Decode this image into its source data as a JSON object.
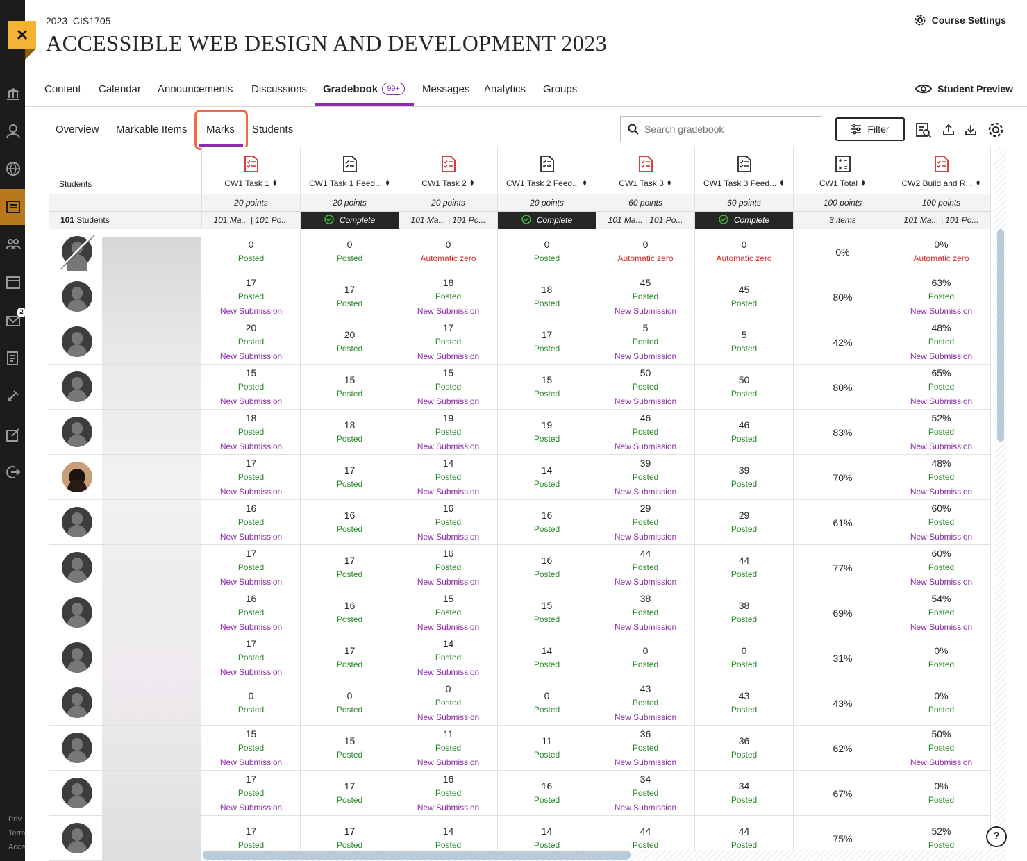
{
  "header": {
    "course_code": "2023_CIS1705",
    "course_title": "ACCESSIBLE WEB DESIGN AND DEVELOPMENT 2023",
    "settings_label": "Course Settings"
  },
  "course_nav": {
    "tabs": [
      "Content",
      "Calendar",
      "Announcements",
      "Discussions",
      "Gradebook",
      "Messages",
      "Analytics",
      "Groups"
    ],
    "gradebook_count": "99+",
    "active_tab": "Gradebook",
    "student_preview_label": "Student Preview"
  },
  "sub_nav": {
    "tabs": [
      "Overview",
      "Markable Items",
      "Marks",
      "Students"
    ],
    "active_tab": "Marks",
    "search_placeholder": "Search gradebook",
    "filter_label": "Filter"
  },
  "left_nav": {
    "message_badge": "2",
    "footer_links": [
      "Priv",
      "Term",
      "Acce"
    ]
  },
  "colors": {
    "accent_purple": "#8d2ea8",
    "posted_green": "#2a8a2a",
    "zero_red": "#d42a2a",
    "highlight_orange": "#f0684b",
    "close_yellow": "#f5b335"
  },
  "grid": {
    "students_header": "Students",
    "students_count": "101 Students",
    "columns": [
      {
        "title": "CW1 Task 1",
        "icon": "assignment-red-icon",
        "points": "20 points",
        "summary": "101 Ma... | 101 Po...",
        "summary_type": "plain"
      },
      {
        "title": "CW1 Task 1 Feed...",
        "icon": "assignment-icon",
        "points": "20 points",
        "summary": "Complete",
        "summary_type": "complete"
      },
      {
        "title": "CW1 Task 2",
        "icon": "assignment-red-icon",
        "points": "20 points",
        "summary": "101 Ma... | 101 Po...",
        "summary_type": "plain"
      },
      {
        "title": "CW1 Task 2 Feed...",
        "icon": "assignment-icon",
        "points": "20 points",
        "summary": "Complete",
        "summary_type": "complete"
      },
      {
        "title": "CW1 Task 3",
        "icon": "assignment-red-icon",
        "points": "60 points",
        "summary": "101 Ma... | 101 Po...",
        "summary_type": "plain"
      },
      {
        "title": "CW1 Task 3 Feed...",
        "icon": "assignment-icon",
        "points": "60 points",
        "summary": "Complete",
        "summary_type": "complete"
      },
      {
        "title": "CW1 Total",
        "icon": "calculation-icon",
        "points": "100 points",
        "summary": "3 items",
        "summary_type": "plain"
      },
      {
        "title": "CW2 Build and R...",
        "icon": "assignment-red-icon",
        "points": "100 points",
        "summary": "101 Ma... | 101 Po...",
        "summary_type": "plain"
      }
    ],
    "status_labels": {
      "posted": "Posted",
      "zero": "Automatic zero",
      "sub": "New Submission"
    },
    "rows": [
      {
        "avatar": "crossed",
        "cells": [
          [
            "0",
            "posted"
          ],
          [
            "0",
            "posted"
          ],
          [
            "0",
            "zero"
          ],
          [
            "0",
            "posted"
          ],
          [
            "0",
            "zero"
          ],
          [
            "0",
            "zero"
          ],
          [
            "0%",
            ""
          ],
          [
            "0%",
            "zero"
          ]
        ]
      },
      {
        "avatar": "default",
        "cells": [
          [
            "17",
            "posted",
            "sub"
          ],
          [
            "17",
            "posted"
          ],
          [
            "18",
            "posted",
            "sub"
          ],
          [
            "18",
            "posted"
          ],
          [
            "45",
            "posted",
            "sub"
          ],
          [
            "45",
            "posted"
          ],
          [
            "80%",
            ""
          ],
          [
            "63%",
            "posted",
            "sub"
          ]
        ]
      },
      {
        "avatar": "default",
        "cells": [
          [
            "20",
            "posted",
            "sub"
          ],
          [
            "20",
            "posted"
          ],
          [
            "17",
            "posted",
            "sub"
          ],
          [
            "17",
            "posted"
          ],
          [
            "5",
            "posted",
            "sub"
          ],
          [
            "5",
            "posted"
          ],
          [
            "42%",
            ""
          ],
          [
            "48%",
            "posted",
            "sub"
          ]
        ]
      },
      {
        "avatar": "default",
        "cells": [
          [
            "15",
            "posted",
            "sub"
          ],
          [
            "15",
            "posted"
          ],
          [
            "15",
            "posted",
            "sub"
          ],
          [
            "15",
            "posted"
          ],
          [
            "50",
            "posted",
            "sub"
          ],
          [
            "50",
            "posted"
          ],
          [
            "80%",
            ""
          ],
          [
            "65%",
            "posted",
            "sub"
          ]
        ]
      },
      {
        "avatar": "default",
        "cells": [
          [
            "18",
            "posted",
            "sub"
          ],
          [
            "18",
            "posted"
          ],
          [
            "19",
            "posted",
            "sub"
          ],
          [
            "19",
            "posted"
          ],
          [
            "46",
            "posted",
            "sub"
          ],
          [
            "46",
            "posted"
          ],
          [
            "83%",
            ""
          ],
          [
            "52%",
            "posted",
            "sub"
          ]
        ]
      },
      {
        "avatar": "dog",
        "cells": [
          [
            "17",
            "posted",
            "sub"
          ],
          [
            "17",
            "posted"
          ],
          [
            "14",
            "posted",
            "sub"
          ],
          [
            "14",
            "posted"
          ],
          [
            "39",
            "posted",
            "sub"
          ],
          [
            "39",
            "posted"
          ],
          [
            "70%",
            ""
          ],
          [
            "48%",
            "posted",
            "sub"
          ]
        ]
      },
      {
        "avatar": "default",
        "cells": [
          [
            "16",
            "posted",
            "sub"
          ],
          [
            "16",
            "posted"
          ],
          [
            "16",
            "posted",
            "sub"
          ],
          [
            "16",
            "posted"
          ],
          [
            "29",
            "posted",
            "sub"
          ],
          [
            "29",
            "posted"
          ],
          [
            "61%",
            ""
          ],
          [
            "60%",
            "posted",
            "sub"
          ]
        ]
      },
      {
        "avatar": "default",
        "cells": [
          [
            "17",
            "posted",
            "sub"
          ],
          [
            "17",
            "posted"
          ],
          [
            "16",
            "posted",
            "sub"
          ],
          [
            "16",
            "posted"
          ],
          [
            "44",
            "posted",
            "sub"
          ],
          [
            "44",
            "posted"
          ],
          [
            "77%",
            ""
          ],
          [
            "60%",
            "posted",
            "sub"
          ]
        ]
      },
      {
        "avatar": "default",
        "cells": [
          [
            "16",
            "posted",
            "sub"
          ],
          [
            "16",
            "posted"
          ],
          [
            "15",
            "posted",
            "sub"
          ],
          [
            "15",
            "posted"
          ],
          [
            "38",
            "posted",
            "sub"
          ],
          [
            "38",
            "posted"
          ],
          [
            "69%",
            ""
          ],
          [
            "54%",
            "posted",
            "sub"
          ]
        ]
      },
      {
        "avatar": "default",
        "cells": [
          [
            "17",
            "posted",
            "sub"
          ],
          [
            "17",
            "posted"
          ],
          [
            "14",
            "posted",
            "sub"
          ],
          [
            "14",
            "posted"
          ],
          [
            "0",
            "posted"
          ],
          [
            "0",
            "posted"
          ],
          [
            "31%",
            ""
          ],
          [
            "0%",
            "posted"
          ]
        ]
      },
      {
        "avatar": "default",
        "cells": [
          [
            "0",
            "posted"
          ],
          [
            "0",
            "posted"
          ],
          [
            "0",
            "posted",
            "sub"
          ],
          [
            "0",
            "posted"
          ],
          [
            "43",
            "posted",
            "sub"
          ],
          [
            "43",
            "posted"
          ],
          [
            "43%",
            ""
          ],
          [
            "0%",
            "posted"
          ]
        ]
      },
      {
        "avatar": "default",
        "cells": [
          [
            "15",
            "posted",
            "sub"
          ],
          [
            "15",
            "posted"
          ],
          [
            "11",
            "posted",
            "sub"
          ],
          [
            "11",
            "posted"
          ],
          [
            "36",
            "posted",
            "sub"
          ],
          [
            "36",
            "posted"
          ],
          [
            "62%",
            ""
          ],
          [
            "50%",
            "posted",
            "sub"
          ]
        ]
      },
      {
        "avatar": "default",
        "cells": [
          [
            "17",
            "posted",
            "sub"
          ],
          [
            "17",
            "posted"
          ],
          [
            "16",
            "posted",
            "sub"
          ],
          [
            "16",
            "posted"
          ],
          [
            "34",
            "posted",
            "sub"
          ],
          [
            "34",
            "posted"
          ],
          [
            "67%",
            ""
          ],
          [
            "0%",
            "posted"
          ]
        ]
      },
      {
        "avatar": "default",
        "cells": [
          [
            "17",
            "posted"
          ],
          [
            "17",
            "posted"
          ],
          [
            "14",
            "posted"
          ],
          [
            "14",
            "posted"
          ],
          [
            "44",
            "posted"
          ],
          [
            "44",
            "posted"
          ],
          [
            "75%",
            ""
          ],
          [
            "52%",
            "posted"
          ]
        ]
      }
    ]
  }
}
